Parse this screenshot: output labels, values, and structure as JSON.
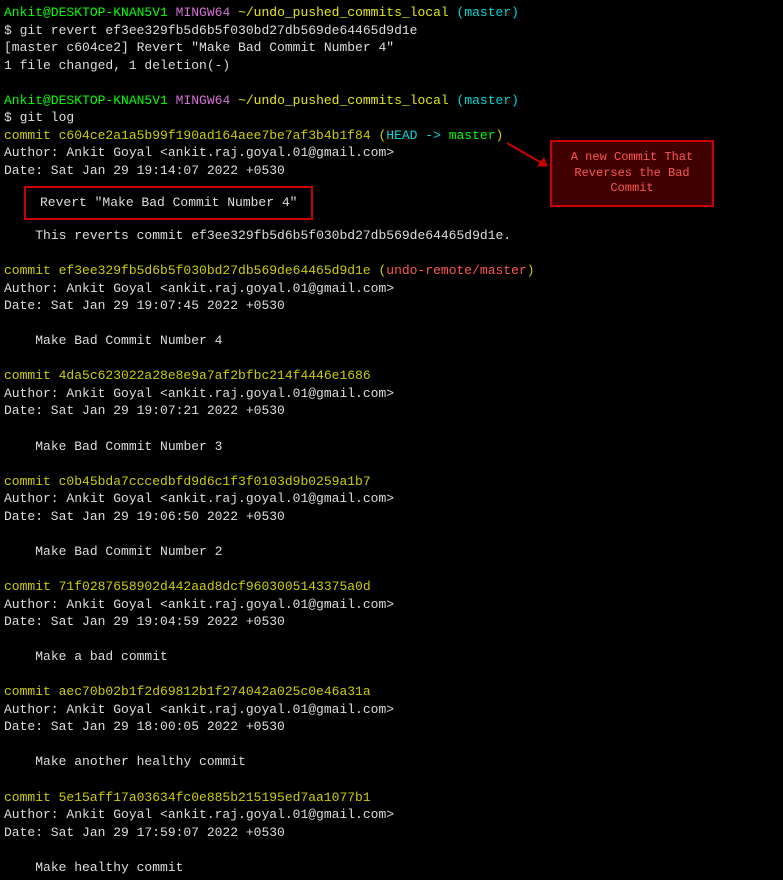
{
  "prompt1": {
    "user": "Ankit@DESKTOP-KNAN5V1",
    "shell": "MINGW64",
    "path": "~/undo_pushed_commits_local",
    "branch": "(master)",
    "cmd": "$ git revert ef3ee329fb5d6b5f030bd27db569de64465d9d1e",
    "out1": "[master c604ce2] Revert \"Make Bad Commit Number 4\"",
    "out2": " 1 file changed, 1 deletion(-)"
  },
  "prompt2": {
    "user": "Ankit@DESKTOP-KNAN5V1",
    "shell": "MINGW64",
    "path": "~/undo_pushed_commits_local",
    "branch": "(master)",
    "cmd": "$ git log"
  },
  "commits": [
    {
      "label": "commit ",
      "hash": "c604ce2a1a5b99f190ad164aee7be7af3b4b1f84",
      "ref_open": " (",
      "head": "HEAD -> ",
      "branch": "master",
      "ref_close": ")",
      "author": "Author: Ankit Goyal <ankit.raj.goyal.01@gmail.com>",
      "date": "Date:   Sat Jan 29 19:14:07 2022 +0530",
      "msg": "Revert \"Make Bad Commit Number 4\"",
      "msg2": "    This reverts commit ef3ee329fb5d6b5f030bd27db569de64465d9d1e."
    },
    {
      "label": "commit ",
      "hash": "ef3ee329fb5d6b5f030bd27db569de64465d9d1e",
      "ref_open": " (",
      "remote": "undo-remote/master",
      "ref_close": ")",
      "author": "Author: Ankit Goyal <ankit.raj.goyal.01@gmail.com>",
      "date": "Date:   Sat Jan 29 19:07:45 2022 +0530",
      "msg": "    Make Bad Commit Number 4"
    },
    {
      "label": "commit ",
      "hash": "4da5c623022a28e8e9a7af2bfbc214f4446e1686",
      "author": "Author: Ankit Goyal <ankit.raj.goyal.01@gmail.com>",
      "date": "Date:   Sat Jan 29 19:07:21 2022 +0530",
      "msg": "    Make Bad Commit Number 3"
    },
    {
      "label": "commit ",
      "hash": "c0b45bda7cccedbfd9d6c1f3f0103d9b0259a1b7",
      "author": "Author: Ankit Goyal <ankit.raj.goyal.01@gmail.com>",
      "date": "Date:   Sat Jan 29 19:06:50 2022 +0530",
      "msg": "    Make Bad Commit Number 2"
    },
    {
      "label": "commit ",
      "hash": "71f0287658902d442aad8dcf9603005143375a0d",
      "author": "Author: Ankit Goyal <ankit.raj.goyal.01@gmail.com>",
      "date": "Date:   Sat Jan 29 19:04:59 2022 +0530",
      "msg": "    Make a bad commit"
    },
    {
      "label": "commit ",
      "hash": "aec70b02b1f2d69812b1f274042a025c0e46a31a",
      "author": "Author: Ankit Goyal <ankit.raj.goyal.01@gmail.com>",
      "date": "Date:   Sat Jan 29 18:00:05 2022 +0530",
      "msg": "    Make another healthy commit"
    },
    {
      "label": "commit ",
      "hash": "5e15aff17a03634fc0e885b215195ed7aa1077b1",
      "author": "Author: Ankit Goyal <ankit.raj.goyal.01@gmail.com>",
      "date": "Date:   Sat Jan 29 17:59:07 2022 +0530",
      "msg": "    Make healthy commit"
    }
  ],
  "annotation": "A new Commit That Reverses the Bad Commit"
}
